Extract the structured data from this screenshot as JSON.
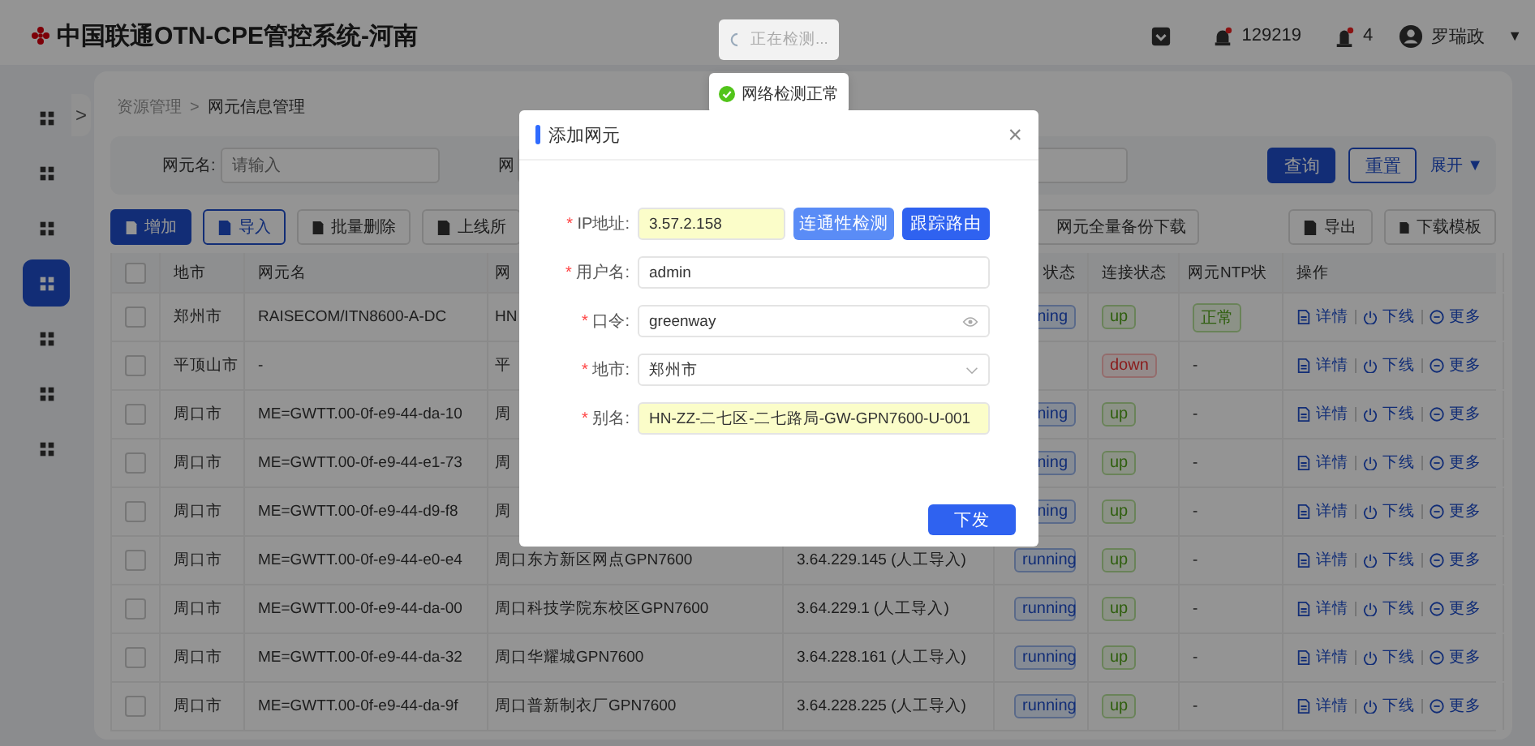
{
  "header": {
    "title": "中国联通OTN-CPE管控系统-河南",
    "alarm_count": "129219",
    "alert_count": "4",
    "user": "罗瑞政",
    "caret": "▼"
  },
  "sidebar": {
    "collapse": ">",
    "items": [
      {
        "selected": false
      },
      {
        "selected": false
      },
      {
        "selected": false
      },
      {
        "selected": true
      },
      {
        "selected": false
      },
      {
        "selected": false
      },
      {
        "selected": false
      }
    ]
  },
  "breadcrumb": {
    "items": [
      "资源管理",
      "网元信息管理"
    ],
    "separator": ">"
  },
  "search": {
    "fields": [
      {
        "label": "网元名:",
        "placeholder": "请输入"
      },
      {
        "label": "网"
      }
    ],
    "buttons": [
      "查询",
      "重置"
    ],
    "expand": "展开",
    "expand_caret": "▼"
  },
  "toolbar": {
    "left": [
      {
        "label": "增加",
        "kind": "primary"
      },
      {
        "label": "导入",
        "kind": "outline"
      },
      {
        "label": "批量删除",
        "kind": "default"
      },
      {
        "label": "上线所",
        "kind": "default"
      }
    ],
    "right": [
      {
        "label": "网元全量备份下载",
        "kind": "default"
      },
      {
        "label": "导出",
        "kind": "default"
      },
      {
        "label": "下载模板",
        "kind": "default"
      }
    ]
  },
  "table": {
    "columns": {
      "city": "地市",
      "name": "网元名",
      "alias": "网",
      "status": "状态",
      "link": "连接状态",
      "ntp": "网元NTP状",
      "actions": "操作"
    },
    "header_checked": false,
    "rows": [
      {
        "checked": false,
        "city": "郑州市",
        "name": "RAISECOM/ITN8600-A-DC",
        "alias": "HN",
        "status": "ning",
        "link": "up",
        "link_ok": true,
        "ntp": {
          "text": "正常",
          "kind": "tag"
        },
        "actions": [
          "详情",
          "下线",
          "更多"
        ]
      },
      {
        "checked": false,
        "city": "平顶山市",
        "name": "-",
        "alias": "平",
        "link": "down",
        "link_ok": false,
        "ntp": {
          "text": "-",
          "kind": "plain"
        },
        "actions": [
          "详情",
          "下线",
          "更多"
        ]
      },
      {
        "checked": false,
        "city": "周口市",
        "name": "ME=GWTT.00-0f-e9-44-da-10",
        "alias": "周",
        "status": "ning",
        "link": "up",
        "link_ok": true,
        "ntp": {
          "text": "-",
          "kind": "plain"
        },
        "actions": [
          "详情",
          "下线",
          "更多"
        ]
      },
      {
        "checked": false,
        "city": "周口市",
        "name": "ME=GWTT.00-0f-e9-44-e1-73",
        "alias": "周",
        "status": "ning",
        "link": "up",
        "link_ok": true,
        "ntp": {
          "text": "-",
          "kind": "plain"
        },
        "actions": [
          "详情",
          "下线",
          "更多"
        ]
      },
      {
        "checked": false,
        "city": "周口市",
        "name": "ME=GWTT.00-0f-e9-44-d9-f8",
        "alias": "周",
        "status": "ning",
        "link": "up",
        "link_ok": true,
        "ntp": {
          "text": "-",
          "kind": "plain"
        },
        "actions": [
          "详情",
          "下线",
          "更多"
        ]
      },
      {
        "checked": false,
        "city": "周口市",
        "name": "ME=GWTT.00-0f-e9-44-e0-e4",
        "alias": "周口东方新区网点GPN7600",
        "ip": "3.64.229.145 (人工导入)",
        "status": "running",
        "link": "up",
        "link_ok": true,
        "ntp": {
          "text": "-",
          "kind": "plain"
        },
        "actions": [
          "详情",
          "下线",
          "更多"
        ]
      },
      {
        "checked": false,
        "city": "周口市",
        "name": "ME=GWTT.00-0f-e9-44-da-00",
        "alias": "周口科技学院东校区GPN7600",
        "ip": "3.64.229.1 (人工导入)",
        "status": "running",
        "link": "up",
        "link_ok": true,
        "ntp": {
          "text": "-",
          "kind": "plain"
        },
        "actions": [
          "详情",
          "下线",
          "更多"
        ]
      },
      {
        "checked": false,
        "city": "周口市",
        "name": "ME=GWTT.00-0f-e9-44-da-32",
        "alias": "周口华耀城GPN7600",
        "ip": "3.64.228.161 (人工导入)",
        "status": "running",
        "link": "up",
        "link_ok": true,
        "ntp": {
          "text": "-",
          "kind": "plain"
        },
        "actions": [
          "详情",
          "下线",
          "更多"
        ]
      },
      {
        "checked": false,
        "city": "周口市",
        "name": "ME=GWTT.00-0f-e9-44-da-9f",
        "alias": "周口普新制衣厂GPN7600",
        "ip": "3.64.228.225 (人工导入)",
        "status": "running",
        "link": "up",
        "link_ok": true,
        "ntp": {
          "text": "-",
          "kind": "plain"
        },
        "actions": [
          "详情",
          "下线",
          "更多"
        ]
      }
    ]
  },
  "dialog": {
    "title": "添加网元",
    "close": "×",
    "required_mark": "*",
    "fields": [
      {
        "label": "IP地址:",
        "value": "3.57.2.158",
        "kind": "ip",
        "required": true,
        "highlight": true
      },
      {
        "label": "用户名:",
        "value": "admin",
        "kind": "text",
        "required": true,
        "highlight": false
      },
      {
        "label": "口令:",
        "value": "greenway",
        "kind": "password",
        "required": true,
        "highlight": false
      },
      {
        "label": "地市:",
        "value": "郑州市",
        "kind": "select",
        "required": true,
        "highlight": false
      },
      {
        "label": "别名:",
        "value": "HN-ZZ-二七区-二七路局-GW-GPN7600-U-001",
        "kind": "text",
        "required": true,
        "highlight": true
      }
    ],
    "ip_buttons": [
      "连通性检测",
      "跟踪路由"
    ],
    "submit": "下发"
  },
  "loading": {
    "text": "正在检测..."
  },
  "message": {
    "text": "网络检测正常"
  }
}
